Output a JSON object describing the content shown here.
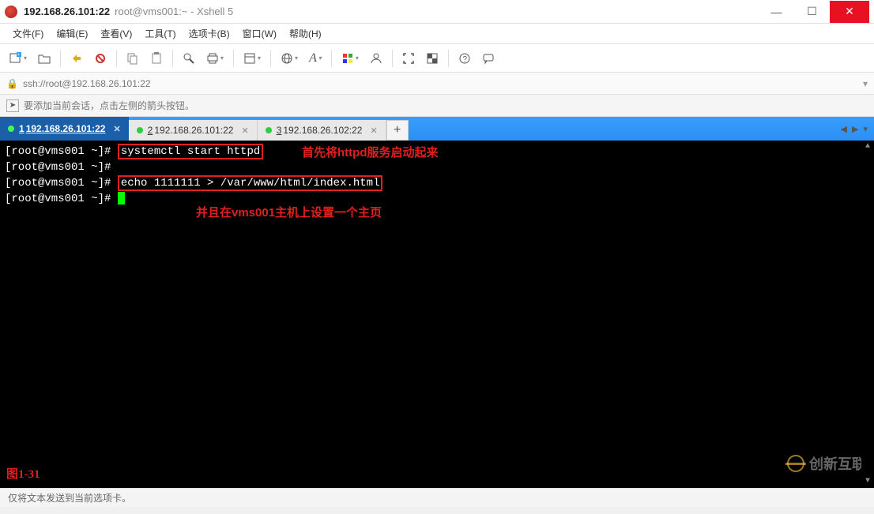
{
  "window": {
    "host_title": "192.168.26.101:22",
    "rest_title": "root@vms001:~ - Xshell 5"
  },
  "menu": {
    "file": "文件(F)",
    "edit": "编辑(E)",
    "view": "查看(V)",
    "tools": "工具(T)",
    "tabs": "选项卡(B)",
    "window": "窗口(W)",
    "help": "帮助(H)"
  },
  "address": {
    "url": "ssh://root@192.168.26.101:22"
  },
  "hint": {
    "text": "要添加当前会话，点击左侧的箭头按钮。"
  },
  "tabs": [
    {
      "num": "1",
      "label": "192.168.26.101:22",
      "active": true
    },
    {
      "num": "2",
      "label": "192.168.26.101:22",
      "active": false
    },
    {
      "num": "3",
      "label": "192.168.26.102:22",
      "active": false
    }
  ],
  "terminal": {
    "prompt1": "[root@vms001 ~]# ",
    "cmd1": "systemctl start httpd",
    "annotation1": "首先将httpd服务启动起来",
    "prompt2": "[root@vms001 ~]#",
    "prompt3": "[root@vms001 ~]# ",
    "cmd2": "echo 1111111 > /var/www/html/index.html",
    "prompt4": "[root@vms001 ~]# ",
    "annotation2": "并且在vms001主机上设置一个主页",
    "figure_label": "图1-31"
  },
  "status": {
    "text": "仅将文本发送到当前选项卡。"
  },
  "watermark": {
    "text": "创新互联"
  }
}
